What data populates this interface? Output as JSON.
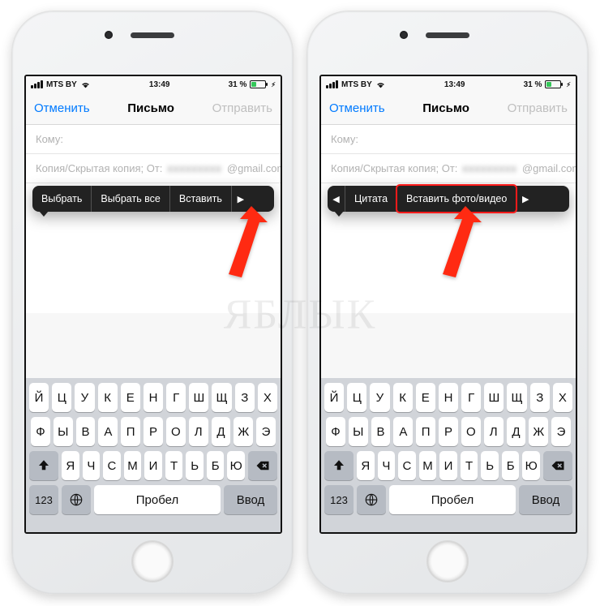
{
  "status": {
    "carrier": "MTS BY",
    "time": "13:49",
    "battery_pct": "31 %"
  },
  "nav": {
    "cancel": "Отменить",
    "title": "Письмо",
    "send": "Отправить"
  },
  "fields": {
    "to_label": "Кому:",
    "cc_label": "Копия/Скрытая копия; От:",
    "from_domain": "@gmail.com"
  },
  "context_menu_left": {
    "items": [
      "Выбрать",
      "Выбрать все",
      "Вставить"
    ],
    "has_next": true
  },
  "context_menu_right": {
    "items": [
      "Цитата",
      "Вставить фото/видео"
    ],
    "has_prev": true,
    "has_next": true,
    "highlight_index": 1
  },
  "keyboard": {
    "row1": [
      "Й",
      "Ц",
      "У",
      "К",
      "Е",
      "Н",
      "Г",
      "Ш",
      "Щ",
      "З",
      "Х"
    ],
    "row2": [
      "Ф",
      "Ы",
      "В",
      "А",
      "П",
      "Р",
      "О",
      "Л",
      "Д",
      "Ж",
      "Э"
    ],
    "row3": [
      "Я",
      "Ч",
      "С",
      "М",
      "И",
      "Т",
      "Ь",
      "Б",
      "Ю"
    ],
    "num": "123",
    "space": "Пробел",
    "enter": "Ввод"
  },
  "watermark": "ЯБЛЫК"
}
